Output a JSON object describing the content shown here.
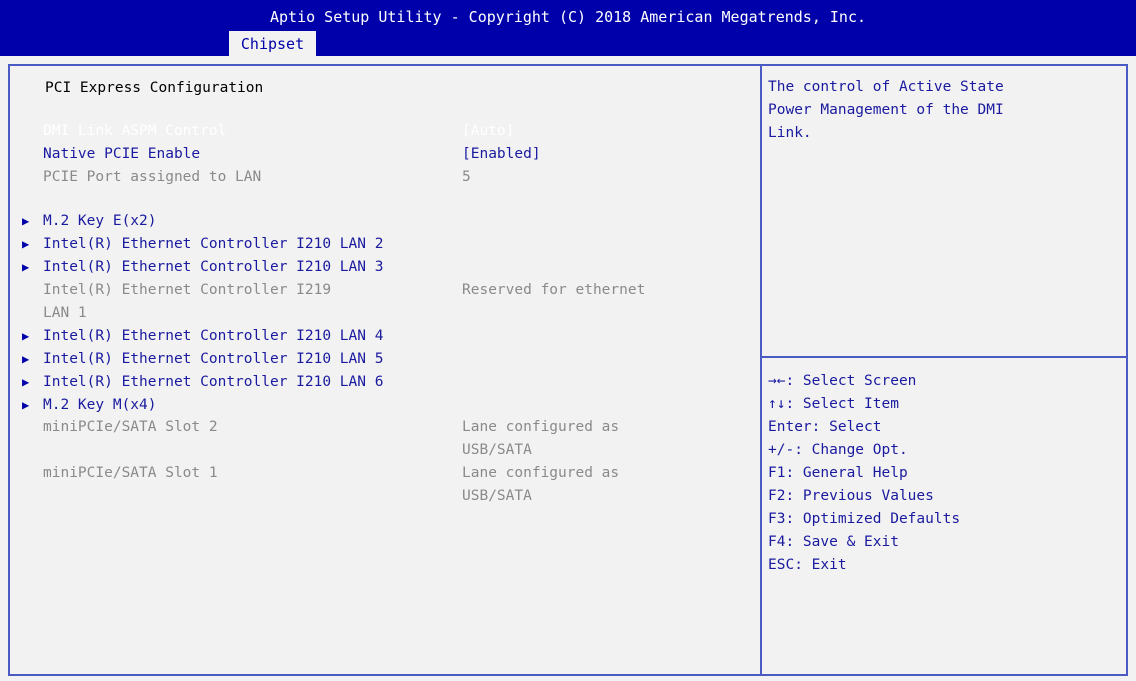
{
  "header": {
    "title": "Aptio Setup Utility - Copyright (C) 2018 American Megatrends, Inc.",
    "active_tab": "Chipset"
  },
  "main": {
    "section_title": "PCI Express Configuration",
    "settings": [
      {
        "label": "DMI Link ASPM Control",
        "value": "[Auto]"
      },
      {
        "label": "Native PCIE Enable",
        "value": "[Enabled]"
      },
      {
        "label": "PCIE Port assigned to LAN",
        "value": "5"
      }
    ],
    "submenus": [
      "M.2 Key E(x2)",
      "Intel(R) Ethernet Controller I210 LAN 2",
      "Intel(R) Ethernet Controller I210 LAN 3",
      "Intel(R) Ethernet Controller I210 LAN 4",
      "Intel(R) Ethernet Controller I210 LAN 5",
      "Intel(R) Ethernet Controller I210 LAN 6",
      "M.2 Key M(x4)"
    ],
    "i219": {
      "label_line1": "Intel(R) Ethernet Controller I219",
      "label_line2": "LAN 1",
      "value": "Reserved for ethernet"
    },
    "slots": [
      {
        "label": "miniPCIe/SATA Slot 2",
        "value_line1": "Lane configured as",
        "value_line2": "USB/SATA"
      },
      {
        "label": "miniPCIe/SATA Slot 1",
        "value_line1": "Lane configured as",
        "value_line2": "USB/SATA"
      }
    ]
  },
  "help": {
    "lines": [
      "The control of Active State",
      "Power Management of the DMI",
      "Link."
    ]
  },
  "keys": [
    "→←: Select Screen",
    "↑↓: Select Item",
    "Enter: Select",
    "+/-: Change Opt.",
    "F1: General Help",
    "F2: Previous Values",
    "F3: Optimized Defaults",
    "F4: Save & Exit",
    "ESC: Exit"
  ],
  "icons": {
    "submenu_arrow": "triangle-right-icon"
  },
  "colors": {
    "header_bg": "#0000aa",
    "background": "#f2f2f2",
    "accent_text": "#1a1aa0",
    "disabled_text": "#8a8a8a",
    "border": "#4a5cc4"
  }
}
